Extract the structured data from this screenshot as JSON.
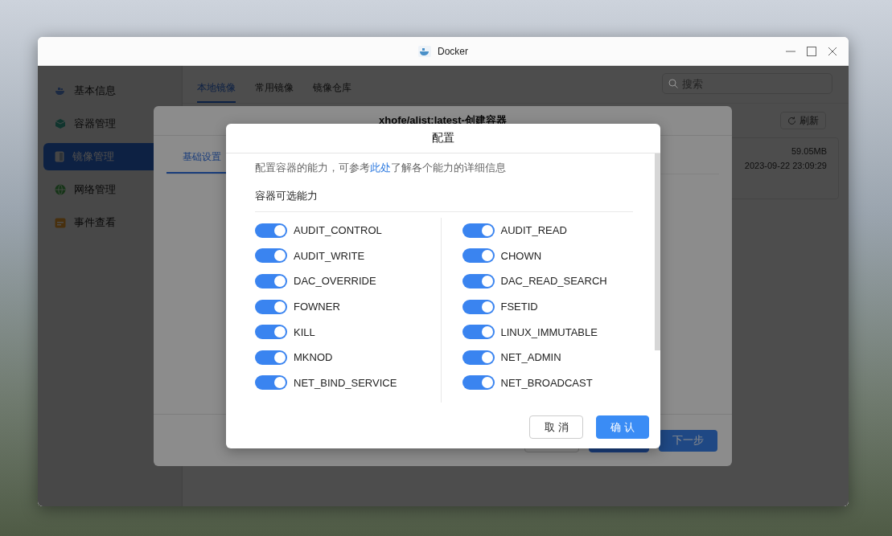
{
  "window": {
    "title": "Docker"
  },
  "sidebar": {
    "items": [
      {
        "label": "基本信息",
        "selected": false
      },
      {
        "label": "容器管理",
        "selected": false
      },
      {
        "label": "镜像管理",
        "selected": true
      },
      {
        "label": "网络管理",
        "selected": false
      },
      {
        "label": "事件查看",
        "selected": false
      }
    ]
  },
  "main": {
    "tabs": [
      {
        "label": "本地镜像",
        "selected": true
      },
      {
        "label": "常用镜像",
        "selected": false
      },
      {
        "label": "镜像仓库",
        "selected": false
      }
    ],
    "search": {
      "placeholder": "搜索"
    },
    "refresh_button": "刷新",
    "image_card": {
      "size": "59.05MB",
      "created": "2023-09-22 23:09:29"
    }
  },
  "create_dialog": {
    "title": "xhofe/alist:latest-创建容器",
    "tabs": [
      {
        "label": "基础设置",
        "selected": true
      }
    ],
    "next_button": "下一步"
  },
  "config_dialog": {
    "title": "配置",
    "description": {
      "before": "配置容器的能力，可参考",
      "link": "此处",
      "after": "了解各个能力的详细信息"
    },
    "section_title": "容器可选能力",
    "columns": [
      {
        "capabilities": [
          {
            "name": "AUDIT_CONTROL",
            "on": true
          },
          {
            "name": "AUDIT_WRITE",
            "on": true
          },
          {
            "name": "DAC_OVERRIDE",
            "on": true
          },
          {
            "name": "FOWNER",
            "on": true
          },
          {
            "name": "KILL",
            "on": true
          },
          {
            "name": "MKNOD",
            "on": true
          },
          {
            "name": "NET_BIND_SERVICE",
            "on": true
          }
        ]
      },
      {
        "capabilities": [
          {
            "name": "AUDIT_READ",
            "on": true
          },
          {
            "name": "CHOWN",
            "on": true
          },
          {
            "name": "DAC_READ_SEARCH",
            "on": true
          },
          {
            "name": "FSETID",
            "on": true
          },
          {
            "name": "LINUX_IMMUTABLE",
            "on": true
          },
          {
            "name": "NET_ADMIN",
            "on": true
          },
          {
            "name": "NET_BROADCAST",
            "on": true
          }
        ]
      }
    ],
    "buttons": {
      "cancel": "取消",
      "confirm": "确认"
    }
  }
}
